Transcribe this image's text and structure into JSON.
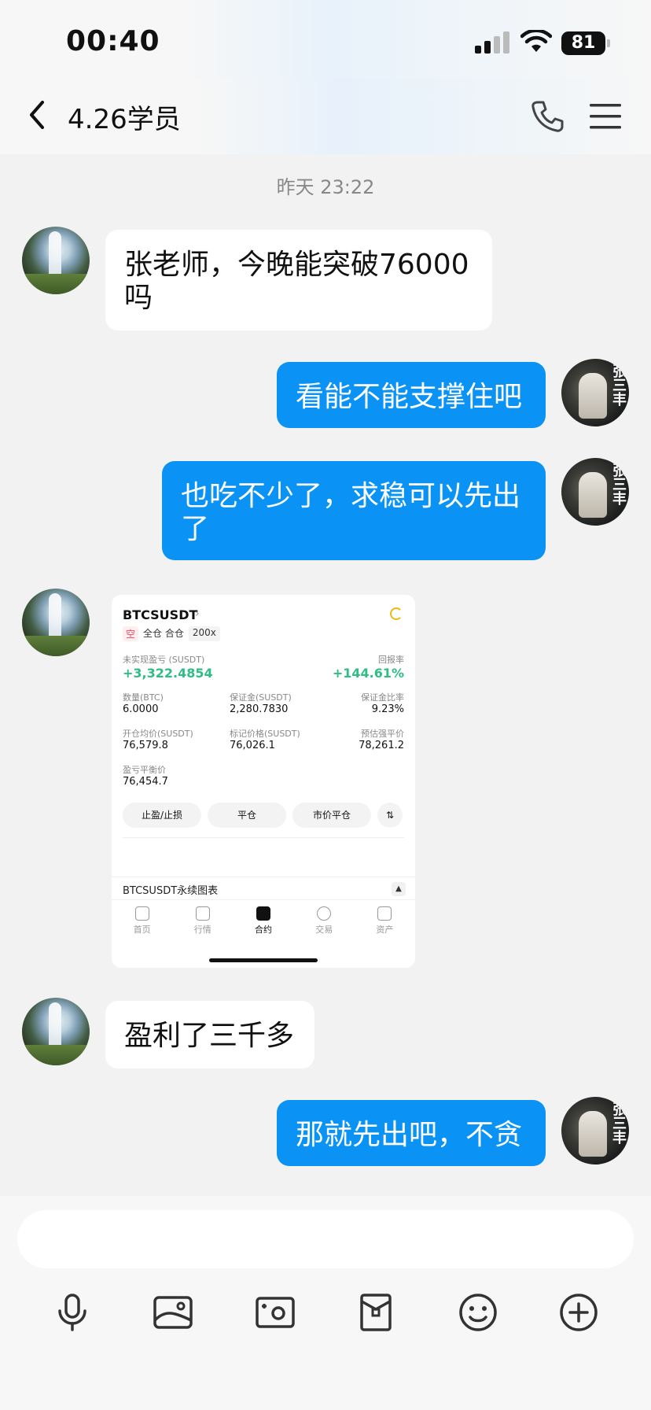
{
  "status_bar": {
    "time": "00:40",
    "battery": "81"
  },
  "nav": {
    "title": "4.26学员"
  },
  "chat": {
    "timestamp": "昨天 23:22",
    "messages": [
      {
        "side": "left",
        "text": "张老师，今晚能突破76000吗"
      },
      {
        "side": "right",
        "text": "看能不能支撑住吧"
      },
      {
        "side": "right",
        "text": "也吃不少了，求稳可以先出了"
      },
      {
        "side": "left",
        "type": "image"
      },
      {
        "side": "left",
        "text": "盈利了三千多"
      },
      {
        "side": "right",
        "text": "那就先出吧，不贪"
      }
    ],
    "avatar_right_name": "张三丰"
  },
  "trade_card": {
    "symbol": "BTCSUSDT",
    "tags": {
      "short": "空",
      "margin": "全仓 合仓",
      "leverage": "200x"
    },
    "pnl_label": "未实现盈亏 (SUSDT)",
    "pnl_value": "+3,322.4854",
    "roi_label": "回报率",
    "roi_value": "+144.61%",
    "qty_label": "数量(BTC)",
    "qty_value": "6.0000",
    "margin_label": "保证金(SUSDT)",
    "margin_value": "2,280.7830",
    "margin_ratio_label": "保证金比率",
    "margin_ratio_value": "9.23%",
    "entry_label": "开仓均价(SUSDT)",
    "entry_value": "76,579.8",
    "mark_label": "标记价格(SUSDT)",
    "mark_value": "76,026.1",
    "liq_label": "预估强平价",
    "liq_value": "78,261.2",
    "breakeven_label": "盈亏平衡价",
    "breakeven_value": "76,454.7",
    "buttons": [
      "止盈/止损",
      "平仓",
      "市价平仓"
    ],
    "perp_chart_label": "BTCSUSDT永续图表",
    "tabs": [
      "首页",
      "行情",
      "合约",
      "交易",
      "资产"
    ]
  },
  "composer": {
    "tools": [
      "microphone-icon",
      "image-icon",
      "camera-icon",
      "red-packet-icon",
      "emoji-icon",
      "plus-icon"
    ]
  }
}
